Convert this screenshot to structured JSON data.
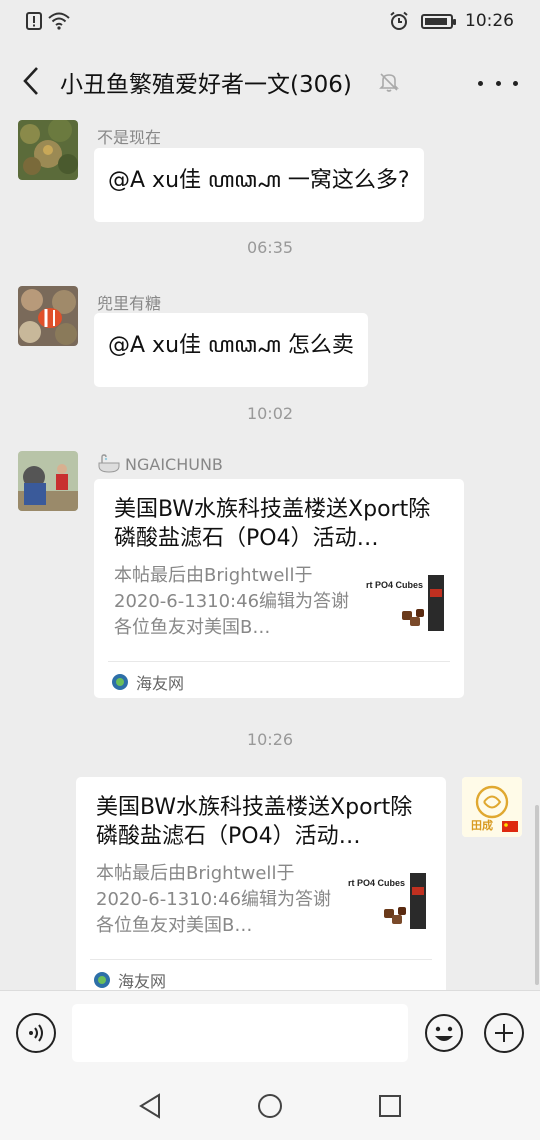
{
  "status_bar": {
    "time": "10:26",
    "icons": [
      "alert-icon",
      "wifi-icon",
      "alarm-icon",
      "battery-icon"
    ],
    "battery_level": 0.9
  },
  "header": {
    "title": "小丑鱼繁殖爱好者一文(306)",
    "muted": true
  },
  "messages": [
    {
      "sender": "不是现在",
      "text": "@A xu佳 ꦲꦣ꧀ꦲ 一窝这么多?"
    },
    {
      "time": "06:35"
    },
    {
      "sender": "兜里有糖",
      "text": "@A xu佳 ꦲꦣ꧀ꦲ 怎么卖"
    },
    {
      "time": "10:02"
    },
    {
      "sender": "NGAICHUNB",
      "card": {
        "title": "美国BW水族科技盖楼送Xport除磷酸盐滤石（PO4）活动…",
        "desc": "本帖最后由Brightwell于2020-6-1310:46编辑为答谢各位鱼友对美国B…",
        "thumb_text": "rt PO4 Cubes",
        "source": "海友网"
      }
    },
    {
      "time": "10:26"
    },
    {
      "self": true,
      "card": {
        "title": "美国BW水族科技盖楼送Xport除磷酸盐滤石（PO4）活动…",
        "desc": "本帖最后由Brightwell于2020-6-1310:46编辑为答谢各位鱼友对美国B…",
        "thumb_text": "rt PO4 Cubes",
        "source": "海友网"
      },
      "avatar_text": "田成"
    }
  ],
  "input": {
    "placeholder": ""
  },
  "colors": {
    "background": "#ededed",
    "bubble": "#ffffff",
    "time": "#999999",
    "sender": "#888888"
  }
}
